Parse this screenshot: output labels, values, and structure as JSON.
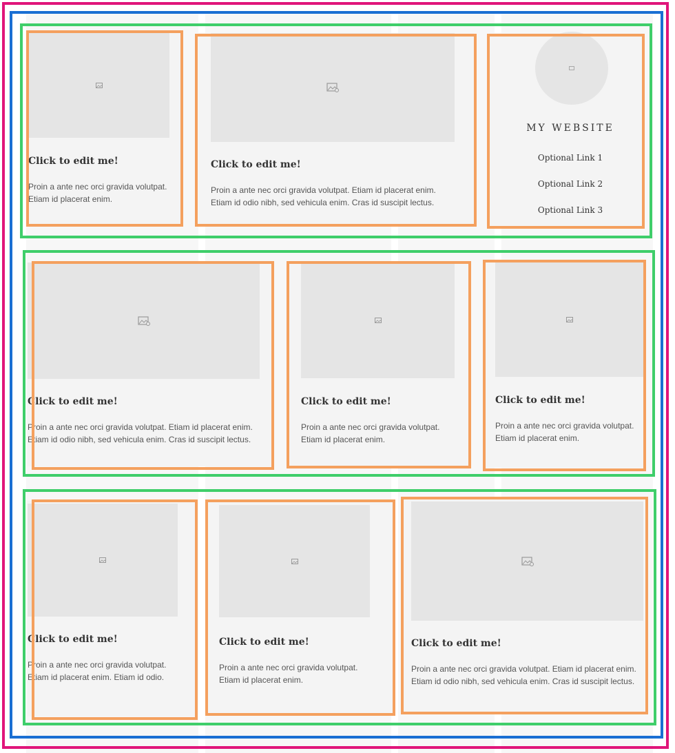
{
  "colors": {
    "outer_frame": "#e0157a",
    "inner_frame": "#1a6fd3",
    "row_frame": "#3fce6a",
    "cell_frame": "#f4a05e",
    "card_background": "#f4f4f4",
    "image_placeholder": "#e5e5e5",
    "text": "#333333"
  },
  "rows": [
    {
      "cards": [
        {
          "title": "Click to edit me!",
          "description": [
            "Proin a ante nec orci gravida volutpat.",
            "Etiam id placerat enim."
          ],
          "image_icon": "image-placeholder-icon"
        },
        {
          "title": "Click to edit me!",
          "description": [
            "Proin a ante nec orci gravida volutpat. Etiam id placerat enim.",
            "Etiam id odio nibh, sed vehicula enim. Cras id suscipit lectus."
          ],
          "image_icon": "image-placeholder-icon"
        }
      ],
      "sidebar": {
        "site_title": "MY WEBSITE",
        "links": [
          "Optional Link 1",
          "Optional Link 2",
          "Optional Link 3"
        ],
        "avatar_icon": "image-placeholder-icon"
      }
    },
    {
      "cards": [
        {
          "title": "Click to edit me!",
          "description": [
            "Proin a ante nec orci gravida volutpat. Etiam id placerat enim.",
            "Etiam id odio nibh, sed vehicula enim. Cras id suscipit lectus."
          ],
          "image_icon": "image-placeholder-icon"
        },
        {
          "title": "Click to edit me!",
          "description": [
            "Proin a ante nec orci gravida volutpat.",
            "Etiam id placerat enim."
          ],
          "image_icon": "image-placeholder-icon"
        },
        {
          "title": "Click to edit me!",
          "description": [
            "Proin a ante nec orci gravida volutpat.",
            "Etiam id placerat enim."
          ],
          "image_icon": "image-placeholder-icon"
        }
      ]
    },
    {
      "cards": [
        {
          "title": "Click to edit me!",
          "description": [
            "Proin a ante nec orci gravida volutpat.",
            "Etiam id placerat enim. Etiam id odio."
          ],
          "image_icon": "image-placeholder-icon"
        },
        {
          "title": "Click to edit me!",
          "description": [
            "Proin a ante nec orci gravida volutpat.",
            "Etiam id placerat enim."
          ],
          "image_icon": "image-placeholder-icon"
        },
        {
          "title": "Click to edit me!",
          "description": [
            "Proin a ante nec orci gravida volutpat. Etiam id placerat enim.",
            "Etiam id odio nibh, sed vehicula enim. Cras id suscipit lectus."
          ],
          "image_icon": "image-placeholder-icon"
        }
      ]
    }
  ]
}
